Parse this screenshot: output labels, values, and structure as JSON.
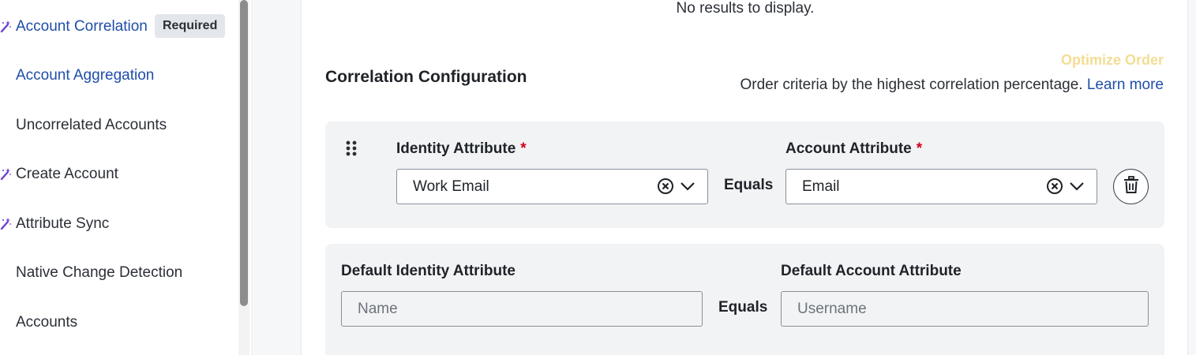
{
  "sidebar": {
    "items": [
      {
        "label": "Account Correlation",
        "badge": "Required",
        "icon": "wand-icon"
      },
      {
        "label": "Account Aggregation"
      },
      {
        "label": "Uncorrelated Accounts"
      },
      {
        "label": "Create Account",
        "icon": "wand-icon"
      },
      {
        "label": "Attribute Sync",
        "icon": "wand-icon"
      },
      {
        "label": "Native Change Detection"
      },
      {
        "label": "Accounts"
      }
    ]
  },
  "main": {
    "no_results": "No results to display.",
    "section_title": "Correlation Configuration",
    "optimize_label": "Optimize Order",
    "order_text": "Order criteria by the highest correlation percentage.",
    "learn_more": "Learn more",
    "criteria": {
      "identity_label": "Identity Attribute",
      "identity_value": "Work Email",
      "equals": "Equals",
      "account_label": "Account Attribute",
      "account_value": "Email",
      "required_mark": "*"
    },
    "defaults": {
      "identity_label": "Default Identity Attribute",
      "identity_placeholder": "Name",
      "equals": "Equals",
      "account_label": "Default Account Attribute",
      "account_placeholder": "Username"
    }
  },
  "colors": {
    "link": "#1f4ea8",
    "wand": "#6b3fd4",
    "required": "#d0021b",
    "optimize_disabled": "#f3dd94"
  }
}
